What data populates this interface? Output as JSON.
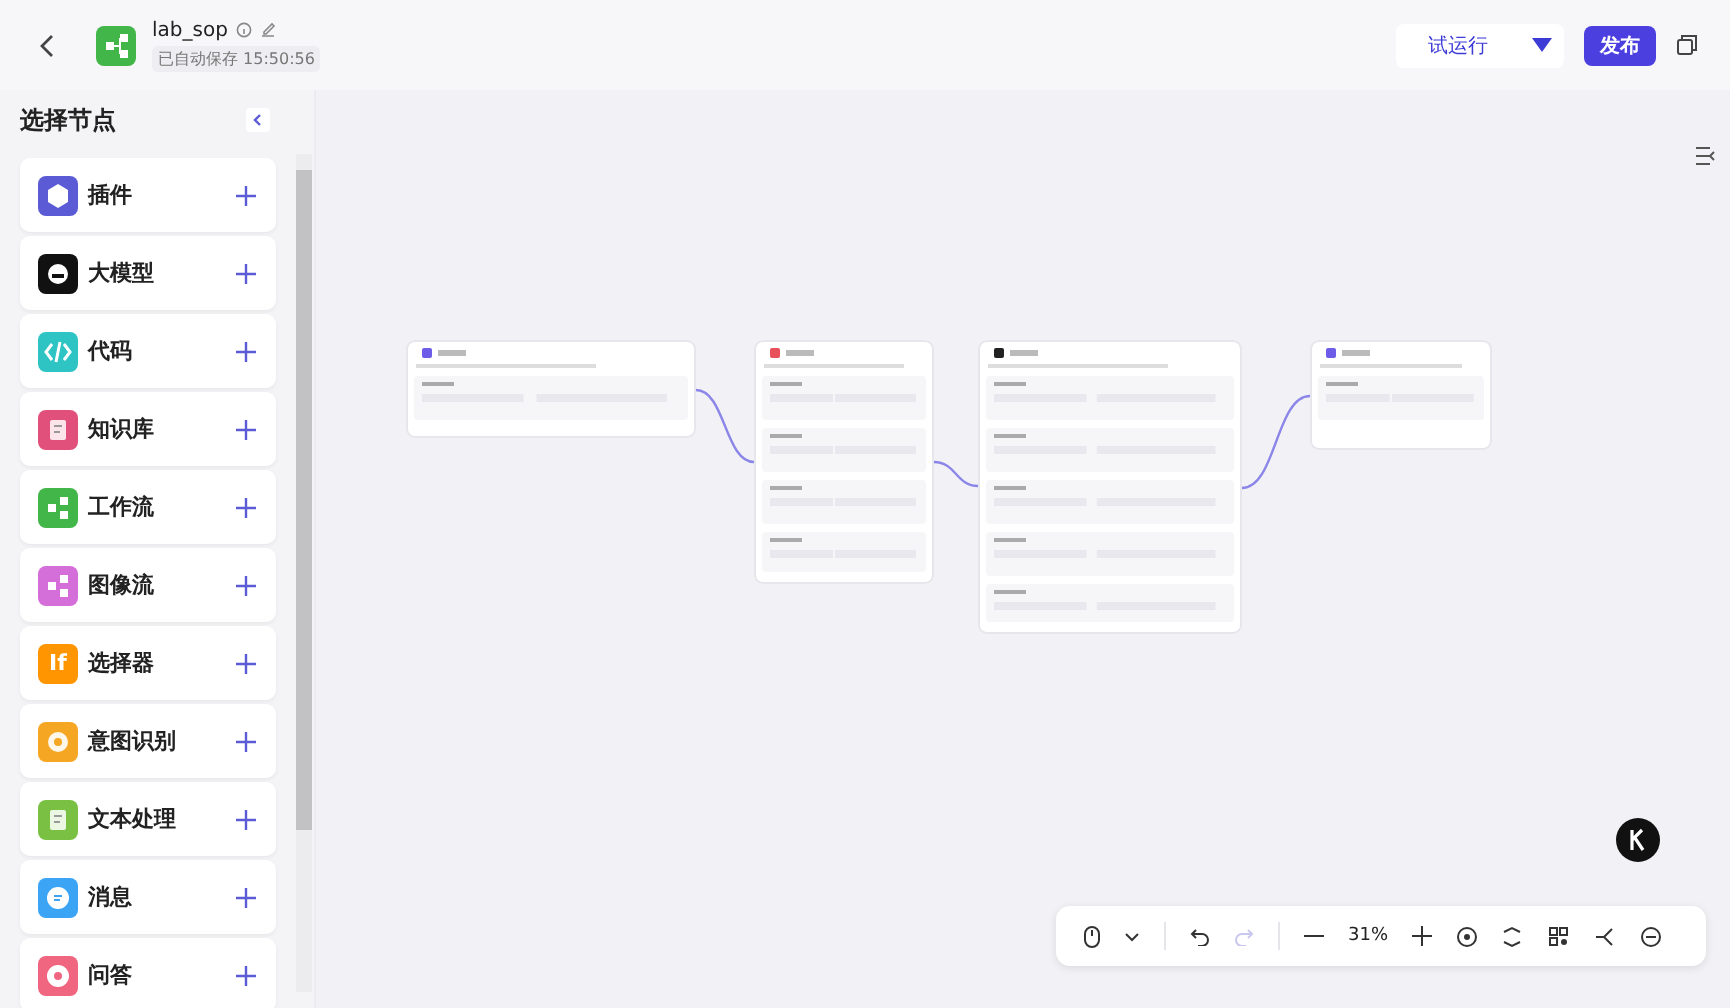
{
  "header": {
    "title": "lab_sop",
    "autosave": "已自动保存 15:50:56",
    "run_button": "试运行",
    "publish_button": "发布"
  },
  "sidebar": {
    "title": "选择节点",
    "items": [
      {
        "label": "插件",
        "kind": "plugin",
        "color": "#5b5bd6"
      },
      {
        "label": "大模型",
        "kind": "model",
        "color": "#111111"
      },
      {
        "label": "代码",
        "kind": "code",
        "color": "#2ec4c4"
      },
      {
        "label": "知识库",
        "kind": "doc",
        "color": "#e0507a"
      },
      {
        "label": "工作流",
        "kind": "flow",
        "color": "#43b649"
      },
      {
        "label": "图像流",
        "kind": "flow",
        "color": "#d46fd9"
      },
      {
        "label": "选择器",
        "kind": "text",
        "icon_label": "If",
        "color": "#ff9500"
      },
      {
        "label": "意图识别",
        "kind": "target",
        "color": "#f5a623"
      },
      {
        "label": "文本处理",
        "kind": "doc",
        "color": "#7ac143"
      },
      {
        "label": "消息",
        "kind": "chat",
        "color": "#3ba4f5"
      },
      {
        "label": "问答",
        "kind": "question",
        "color": "#f06680"
      }
    ]
  },
  "canvas": {
    "nodes": [
      {
        "color": "#6c5ce7"
      },
      {
        "color": "#e8505b"
      },
      {
        "color": "#222222"
      },
      {
        "color": "#6c5ce7"
      }
    ]
  },
  "toolbar": {
    "zoom": "31%",
    "redo": {
      "disabled": true
    }
  }
}
